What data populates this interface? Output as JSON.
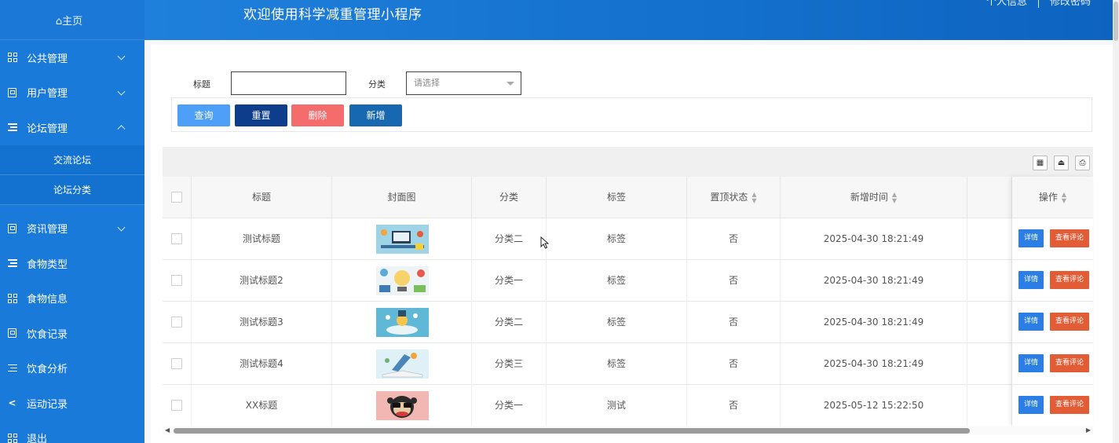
{
  "sidebar": {
    "home_label": "⌂主页",
    "menus": [
      {
        "label": "公共管理",
        "icon": "grid-icon",
        "expanded": false
      },
      {
        "label": "用户管理",
        "icon": "book-icon",
        "expanded": false
      },
      {
        "label": "论坛管理",
        "icon": "list-icon",
        "expanded": true
      }
    ],
    "submenu": [
      {
        "label": "交流论坛"
      },
      {
        "label": "论坛分类"
      }
    ],
    "menus2": [
      {
        "label": "资讯管理",
        "icon": "book-icon",
        "expanded": false
      },
      {
        "label": "食物类型",
        "icon": "list-icon"
      },
      {
        "label": "食物信息",
        "icon": "grid-icon"
      },
      {
        "label": "饮食记录",
        "icon": "book-icon"
      },
      {
        "label": "饮食分析",
        "icon": "list-icon"
      },
      {
        "label": "运动记录",
        "icon": "share-icon"
      },
      {
        "label": "退出",
        "icon": "grid-icon"
      }
    ]
  },
  "header": {
    "title": "欢迎使用科学减重管理小程序",
    "profile_link": "个人信息",
    "password_link": "修改密码"
  },
  "filters": {
    "title_label": "标题",
    "title_value": "",
    "category_label": "分类",
    "category_placeholder": "请选择"
  },
  "buttons": {
    "query": "查询",
    "reset": "重置",
    "delete": "删除",
    "add": "新增"
  },
  "table": {
    "columns": [
      "标题",
      "封面图",
      "分类",
      "标签",
      "置顶状态",
      "新增时间",
      "",
      "操作"
    ],
    "sortable": [
      false,
      false,
      false,
      false,
      true,
      true,
      false,
      true
    ],
    "rows": [
      {
        "title": "测试标题",
        "cover": "cover-1",
        "category": "分类二",
        "tag": "标签",
        "pinned": "否",
        "created": "2025-04-30 18:21:49"
      },
      {
        "title": "测试标题2",
        "cover": "cover-2",
        "category": "分类一",
        "tag": "标签",
        "pinned": "否",
        "created": "2025-04-30 18:21:49"
      },
      {
        "title": "测试标题3",
        "cover": "cover-3",
        "category": "分类二",
        "tag": "标签",
        "pinned": "否",
        "created": "2025-04-30 18:21:49"
      },
      {
        "title": "测试标题4",
        "cover": "cover-4",
        "category": "分类三",
        "tag": "标签",
        "pinned": "否",
        "created": "2025-04-30 18:21:49"
      },
      {
        "title": "XX标题",
        "cover": "cover-5",
        "category": "分类一",
        "tag": "测试",
        "pinned": "否",
        "created": "2025-05-12 15:22:50"
      }
    ],
    "row_actions": {
      "detail": "详情",
      "comments": "查看评论"
    }
  },
  "colors": {
    "sidebar": "#1a7ad9",
    "header": "#1370cc",
    "query_btn": "#4d9ff7",
    "reset_btn": "#0e3d8c",
    "delete_btn": "#f46c6c",
    "add_btn": "#1867b1",
    "detail_btn": "#2a7ee6",
    "comment_btn": "#e25d35"
  }
}
